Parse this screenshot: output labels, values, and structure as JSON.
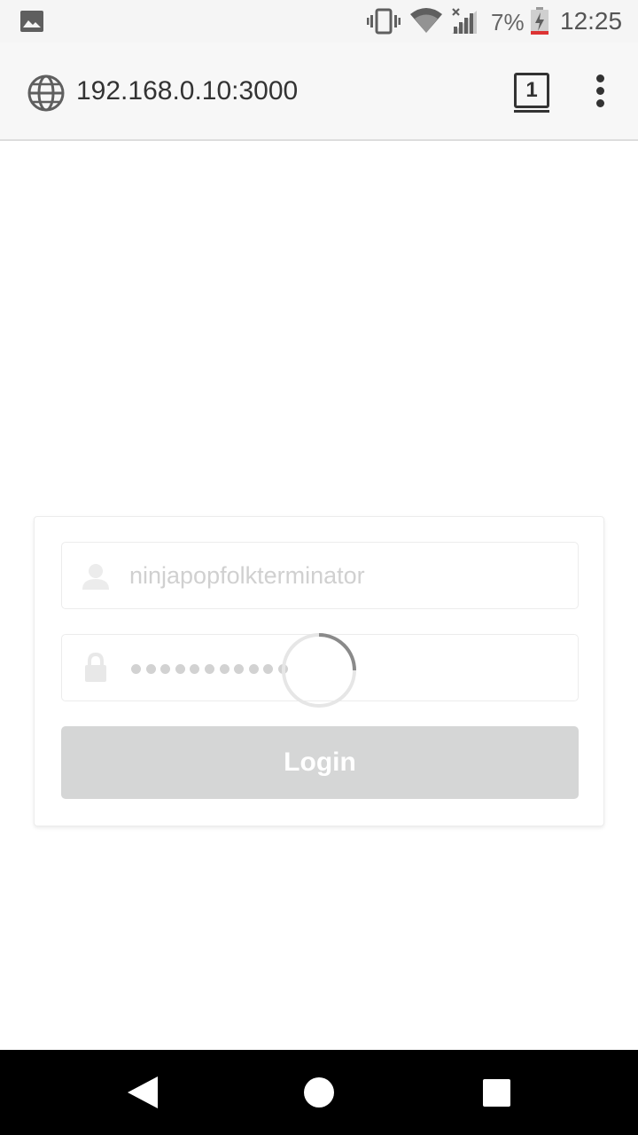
{
  "status_bar": {
    "battery_percent": "7%",
    "time": "12:25",
    "icons": [
      "image-icon",
      "vibrate-icon",
      "wifi-icon",
      "signal-icon",
      "battery-charging-icon"
    ]
  },
  "browser": {
    "url": "192.168.0.10:3000",
    "tab_count": "1",
    "icons": [
      "globe-icon",
      "overflow-menu-icon"
    ]
  },
  "login": {
    "username_value": "ninjapopfolkterminator",
    "password_mask_length": 11,
    "button_label": "Login",
    "button_state": "disabled-loading",
    "icons": [
      "user-icon",
      "lock-icon",
      "loading-spinner"
    ]
  },
  "nav_bar": {
    "icons": [
      "back-icon",
      "home-icon",
      "recents-icon"
    ]
  },
  "colors": {
    "status_bar_bg": "#f5f5f5",
    "url_bar_bg": "#f7f7f7",
    "button_bg_disabled": "#d5d6d6",
    "placeholder_text": "#d0d0d0",
    "nav_bar_bg": "#000000"
  }
}
